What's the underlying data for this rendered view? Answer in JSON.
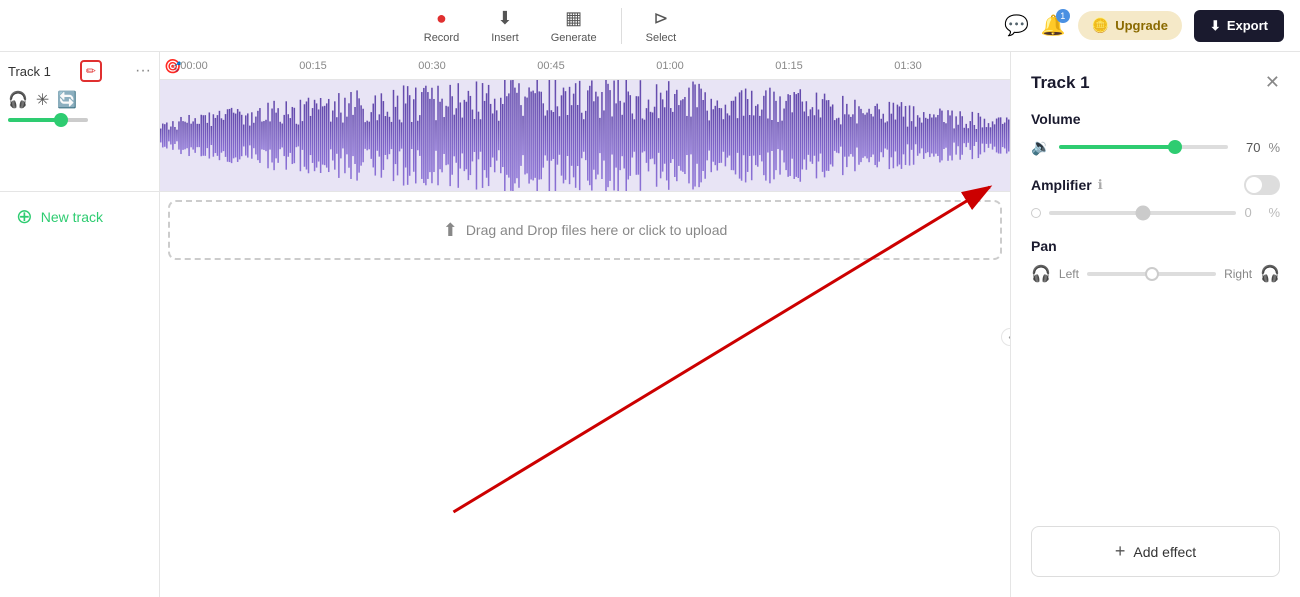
{
  "toolbar": {
    "record_label": "Record",
    "insert_label": "Insert",
    "generate_label": "Generate",
    "select_label": "Select",
    "upgrade_label": "Upgrade",
    "export_label": "Export",
    "bell_count": "1"
  },
  "ruler": {
    "marks": [
      "00:00",
      "00:15",
      "00:30",
      "00:45",
      "01:00",
      "01:15",
      "01:30"
    ]
  },
  "track": {
    "name": "Track 1",
    "volume": 70
  },
  "new_track": {
    "label": "New track"
  },
  "drop_zone": {
    "text": "Drag and Drop files here or click to upload"
  },
  "right_panel": {
    "title": "Track 1",
    "volume_label": "Volume",
    "volume_value": "70",
    "volume_pct": "%",
    "amplifier_label": "Amplifier",
    "amplifier_value": "0",
    "amplifier_pct": "%",
    "pan_label": "Pan",
    "pan_left": "Left",
    "pan_right": "Right",
    "add_effect_label": "Add effect"
  }
}
